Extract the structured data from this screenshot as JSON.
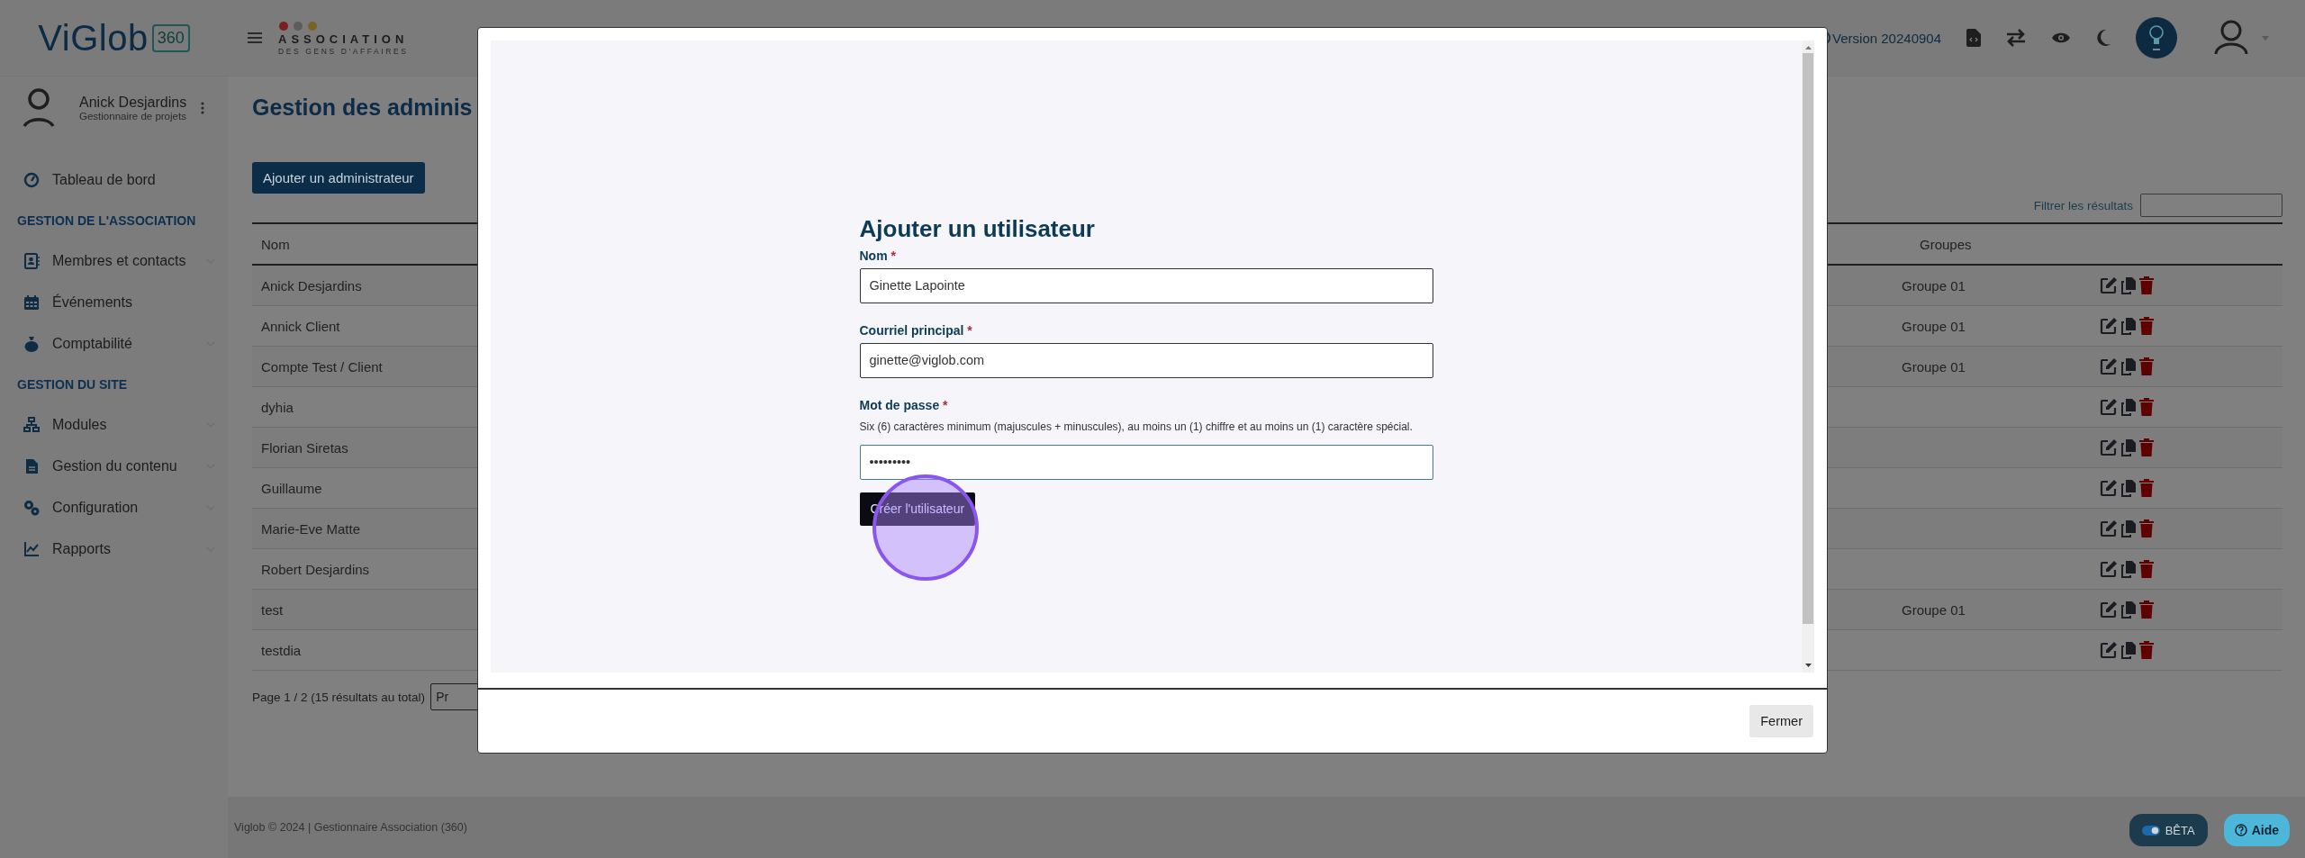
{
  "brand": {
    "name": "ViGlob",
    "badge": "360"
  },
  "org_logo": {
    "title": "ASSOCIATION",
    "subtitle": "DES GENS D'AFFAIRES"
  },
  "header": {
    "version": "Version 20240904"
  },
  "user": {
    "name": "Anick Desjardins",
    "role": "Gestionnaire de projets"
  },
  "sidebar": {
    "items": [
      {
        "kind": "link",
        "label": "Tableau de bord"
      },
      {
        "kind": "section",
        "label": "GESTION DE L'ASSOCIATION"
      },
      {
        "kind": "menu",
        "label": "Membres et contacts"
      },
      {
        "kind": "link",
        "label": "Événements"
      },
      {
        "kind": "menu",
        "label": "Comptabilité"
      },
      {
        "kind": "section",
        "label": "GESTION DU SITE"
      },
      {
        "kind": "menu",
        "label": "Modules"
      },
      {
        "kind": "menu",
        "label": "Gestion du contenu"
      },
      {
        "kind": "menu",
        "label": "Configuration"
      },
      {
        "kind": "menu",
        "label": "Rapports"
      }
    ]
  },
  "page": {
    "title": "Gestion des adminis",
    "add_button": "Ajouter un administrateur",
    "filter": {
      "label": "Filtrer les résultats"
    },
    "table": {
      "columns": [
        "Nom",
        "Groupes"
      ],
      "rows": [
        {
          "name": "Anick Desjardins",
          "group": "Groupe 01"
        },
        {
          "name": "Annick Client",
          "group": "Groupe 01"
        },
        {
          "name": "Compte Test / Client",
          "group": "Groupe 01"
        },
        {
          "name": "dyhia",
          "group": ""
        },
        {
          "name": "Florian Siretas",
          "group": ""
        },
        {
          "name": "Guillaume",
          "group": ""
        },
        {
          "name": "Marie-Eve Matte",
          "group": ""
        },
        {
          "name": "Robert Desjardins",
          "group": ""
        },
        {
          "name": "test",
          "group": "Groupe 01"
        },
        {
          "name": "testdia",
          "group": ""
        }
      ]
    },
    "pagination": {
      "summary": "Page 1 / 2 (15 résultats au total)",
      "button": "Pr"
    }
  },
  "modal": {
    "title": "Ajouter un utilisateur",
    "fields": [
      {
        "label": "Nom",
        "required_mark": "*",
        "value": "Ginette Lapointe",
        "focused": false
      },
      {
        "label": "Courriel principal",
        "required_mark": "*",
        "value": "ginette@viglob.com",
        "focused": false
      },
      {
        "label": "Mot de passe",
        "required_mark": "*",
        "help": "Six (6) caractères minimum (majuscules + minuscules), au moins un (1) chiffre et au moins un (1) caractère spécial.",
        "value": "•••••••••",
        "focused": true
      }
    ],
    "submit": "Créer l'utilisateur",
    "close": "Fermer"
  },
  "footer": {
    "text": "Viglob © 2024 | Gestionnaire Association (360)"
  },
  "beta": {
    "label": "BÊTA",
    "on": true
  },
  "help_button": "Aide"
}
